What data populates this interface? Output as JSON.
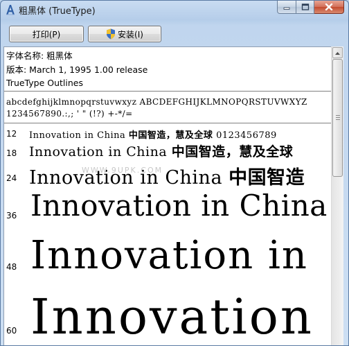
{
  "window": {
    "title": "粗黑体 (TrueType)"
  },
  "toolbar": {
    "print_label": "打印(P)",
    "install_label": "安装(I)"
  },
  "font_info": {
    "name_line": "字体名称: 粗黑体",
    "version_line": "版本: March 1, 1995 1.00 release",
    "type_line": "TrueType Outlines"
  },
  "charset": {
    "line1": "abcdefghijklmnopqrstuvwxyz ABCDEFGHIJKLMNOPQRSTUVWXYZ",
    "line2": "1234567890.:,; ' \" (!?) +-*/="
  },
  "samples": [
    {
      "size": "12",
      "latin": "Innovation in China",
      "cjk": "中国智造，慧及全球",
      "digits": "0123456789"
    },
    {
      "size": "18",
      "latin": "Innovation in China",
      "cjk": "中国智造，慧及全球"
    },
    {
      "size": "24",
      "latin": "Innovation in China",
      "cjk": "中国智造"
    },
    {
      "size": "36",
      "latin": "Innovation in China"
    },
    {
      "size": "48",
      "latin": "Innovation in"
    },
    {
      "size": "60",
      "latin": "Innovation"
    }
  ],
  "watermark": "WWW.9UPK.COM",
  "colors": {
    "title_bar": "#b5cde9",
    "close_button": "#c44b2f",
    "content_bg": "#ffffff"
  },
  "icons": [
    "font-app-icon",
    "minimize-icon",
    "maximize-icon",
    "close-icon",
    "uac-shield-icon",
    "scroll-up-arrow-icon"
  ]
}
